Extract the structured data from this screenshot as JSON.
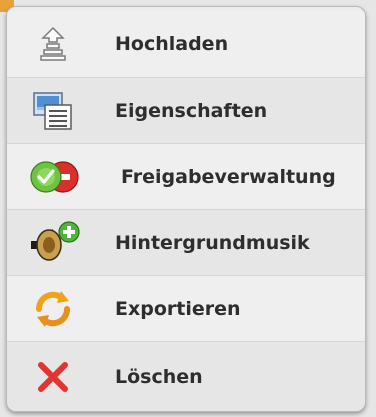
{
  "menu": {
    "items": [
      {
        "label": "Hochladen",
        "icon": "upload-icon"
      },
      {
        "label": "Eigenschaften",
        "icon": "properties-icon"
      },
      {
        "label": "Freigabeverwaltung",
        "icon": "share-management-icon"
      },
      {
        "label": "Hintergrundmusik",
        "icon": "background-music-icon"
      },
      {
        "label": "Exportieren",
        "icon": "export-icon"
      },
      {
        "label": "Löschen",
        "icon": "delete-icon"
      }
    ]
  },
  "colors": {
    "menu_bg": "#ececec",
    "text": "#2e2e2e",
    "accent": "#e9a13a",
    "delete_red": "#e3342f",
    "ok_green": "#5cc13b",
    "export_orange": "#f0a21b"
  }
}
